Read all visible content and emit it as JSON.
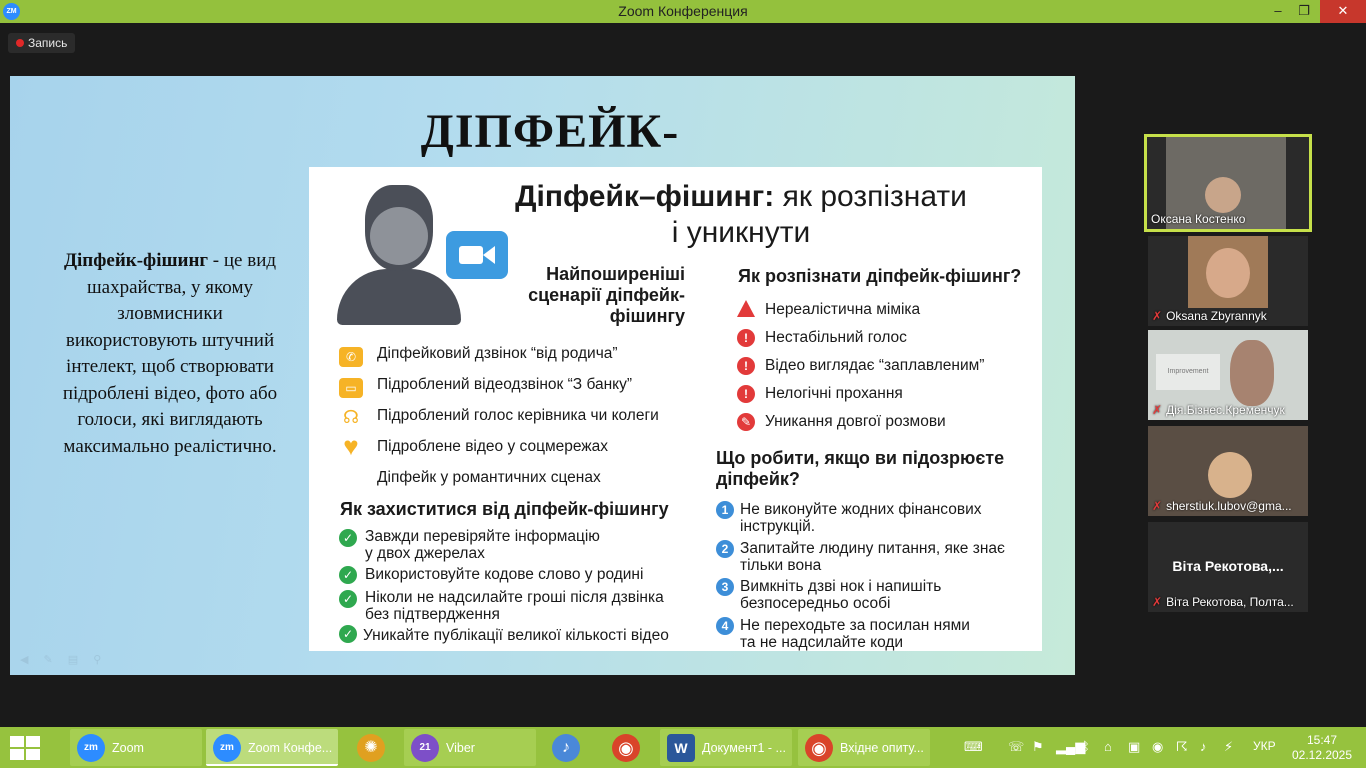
{
  "window": {
    "app_icon": "ZM",
    "title": "Zoom Конференция",
    "minimize": "–",
    "restore": "❐",
    "close": "✕"
  },
  "recording": {
    "label": "Запись"
  },
  "slide": {
    "title": "ДІПФЕЙК-ФІШИНГ",
    "left_text_bold": "Діпфейк-фішинг",
    "left_text": " - це вид шахрайства, у якому зловмисники використовують штучний інтелект, щоб створювати підроблені відео, фото або голоси, які виглядають максимально реалістично.",
    "nav_icons": "◀ ✎ ▤ ⚲"
  },
  "infographic": {
    "title_bold": "Діпфейк–фішинг:",
    "title_rest": " як розпізнати",
    "title_line2": "і уникнути",
    "scenarios": {
      "heading": "Найпоширеніші сценарії діпфейк-фішингу",
      "items": [
        {
          "icon": "phone-icon",
          "glyph": "✆",
          "text": "Діпфейковий дзвінок “від родича”"
        },
        {
          "icon": "id-card-icon",
          "glyph": "▭",
          "text": "Підроблений відеодзвінок “З банку”"
        },
        {
          "icon": "speaker-person-icon",
          "glyph": "☊",
          "text": "Підроблений голос керівника чи колеги"
        },
        {
          "icon": "heart-icon",
          "glyph": "♥",
          "text": "Підроблене відео у соцмережах"
        },
        {
          "icon": "",
          "glyph": "",
          "text": "Діпфейк у романтичних сценах"
        }
      ]
    },
    "protect": {
      "heading": "Як захиститися від діпфейк-фішингу",
      "items": [
        {
          "line1": "Завжди перевіряйте інформацію",
          "line2": "у двох джерелах"
        },
        {
          "line1": "Використовуйте кодове слово у родині",
          "line2": ""
        },
        {
          "line1": "Ніколи не надсилайте гроші після дзвінка",
          "line2": "без підтвердження"
        },
        {
          "line1": "Уникайте публікації великої кількості відео",
          "line2": ""
        }
      ]
    },
    "recognize": {
      "heading": "Як розпізнати діпфейк-фішинг?",
      "items": [
        {
          "glyph": "!",
          "text": "Нереалістична міміка"
        },
        {
          "glyph": "!",
          "text": "Нестабільний голос"
        },
        {
          "glyph": "!",
          "text": "Відео виглядає “заплавленим”"
        },
        {
          "glyph": "!",
          "text": "Нелогічні прохання"
        },
        {
          "glyph": "✎",
          "text": "Уникання довгої розмови"
        }
      ]
    },
    "todo": {
      "heading_line1": "Що робити, якщо ви підозрюєте",
      "heading_line2": "діпфейк?",
      "items": [
        {
          "num": "1",
          "line1": "Не виконуйте жодних фінансових",
          "line2": "інструкцій."
        },
        {
          "num": "2",
          "line1": "Запитайте людину питання, яке знає",
          "line2": "тільки вона"
        },
        {
          "num": "3",
          "line1": "Вимкніть дзві нок і напишіть",
          "line2": "безпосередньо особі"
        },
        {
          "num": "4",
          "line1": "Не переходьте за посилан нями",
          "line2": "та не надсилайте коди"
        }
      ]
    }
  },
  "participants": [
    {
      "name": "Оксана Костенко",
      "muted": false,
      "active": true,
      "bg": "#6d6a64"
    },
    {
      "name": "Oksana Zbyrannyk",
      "muted": true,
      "active": false,
      "bg": "#9a7a5a"
    },
    {
      "name": "Дія.Бізнес.Кременчук",
      "muted": true,
      "active": false,
      "bg": "#cfd4d0"
    },
    {
      "name": "sherstiuk.lubov@gma...",
      "muted": true,
      "active": false,
      "bg": "#5a4e44"
    },
    {
      "name": "Віта Рекотова, Полта...",
      "muted": true,
      "active": false,
      "bg": "#1e1e1e",
      "center_name": "Віта  Рекотова,..."
    }
  ],
  "taskbar": {
    "items": [
      {
        "label": "Zoom",
        "icon": "zoom-icon",
        "glyph": "zm",
        "color": "#2d8cff"
      },
      {
        "label": "Zoom Конфе...",
        "icon": "zoom-icon",
        "glyph": "zm",
        "color": "#2d8cff"
      },
      {
        "label": "",
        "icon": "picasa-icon",
        "glyph": "✺",
        "color": "#e0a020"
      },
      {
        "label": "Viber",
        "icon": "viber-icon",
        "glyph": "21",
        "color": "#7d4fc8"
      },
      {
        "label": "",
        "icon": "speaker-icon",
        "glyph": "♪",
        "color": "#4a88d8"
      },
      {
        "label": "",
        "icon": "chrome-icon",
        "glyph": "◉",
        "color": "#d9442a"
      },
      {
        "label": "Документ1 - ...",
        "icon": "word-icon",
        "glyph": "W",
        "color": "#2b579a"
      },
      {
        "label": "Вхідне опиту...",
        "icon": "chrome-icon",
        "glyph": "◉",
        "color": "#d9442a"
      }
    ],
    "lang": "УКР",
    "time": "15:47",
    "date": "02.12.2025"
  }
}
